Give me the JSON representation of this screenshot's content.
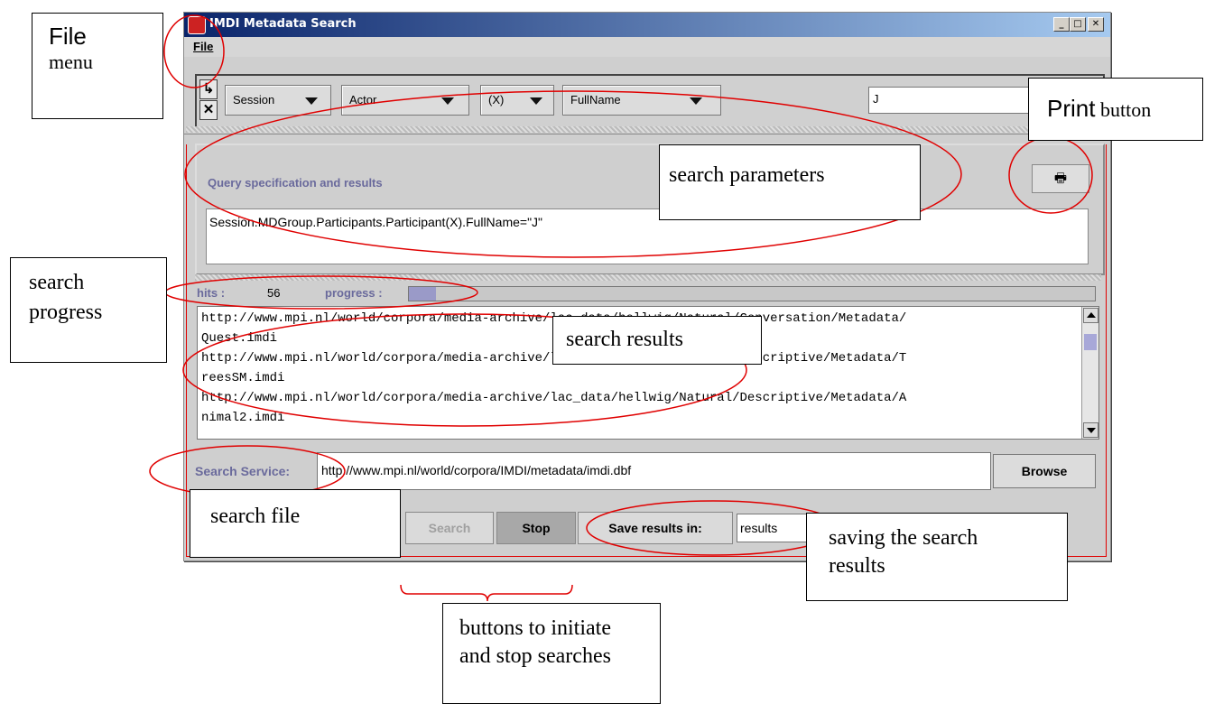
{
  "window": {
    "title": "IMDI Metadata Search",
    "minimize_glyph": "_",
    "maximize_glyph": "□",
    "close_glyph": "✕"
  },
  "menu": {
    "file": "File"
  },
  "query_builder": {
    "icon_insert": "↳",
    "icon_delete": "✕",
    "combos": [
      "Session",
      "Actor",
      "(X)",
      "FullName"
    ],
    "value": "J"
  },
  "query_panel": {
    "heading": "Query specification and results",
    "query": "Session.MDGroup.Participants.Participant(X).FullName=\"J\"",
    "print_icon": "print-icon"
  },
  "progress": {
    "hits_label": "hits :",
    "hits_value": "56",
    "progress_label": "progress :",
    "fraction": 0.04
  },
  "results": {
    "lines": [
      "http://www.mpi.nl/world/corpora/media-archive/lac_data/hellwig/Natural/Conversation/Metadata/",
      "Quest.imdi",
      "http://www.mpi.nl/world/corpora/media-archive/lac_data/hellwig/Natural/Descriptive/Metadata/T",
      "reesSM.imdi",
      "http://www.mpi.nl/world/corpora/media-archive/lac_data/hellwig/Natural/Descriptive/Metadata/A",
      "nimal2.imdi"
    ]
  },
  "service": {
    "label": "Search Service:",
    "url": "http://www.mpi.nl/world/corpora/IMDI/metadata/imdi.dbf",
    "browse": "Browse"
  },
  "actions": {
    "search": "Search",
    "stop": "Stop",
    "save_label": "Save results in:",
    "save_value": "results"
  },
  "annotations": {
    "file_menu_1": "File",
    "file_menu_2": "menu",
    "print_1": "Print",
    "print_2": " button",
    "search_parameters": "search parameters",
    "search_progress_1": "search",
    "search_progress_2": "progress",
    "search_results": "search results",
    "search_file": "search file",
    "saving_1": "saving the search",
    "saving_2": "results",
    "buttons_1": "buttons to initiate",
    "buttons_2": "and stop searches"
  },
  "colors": {
    "annotation_red": "#e00000",
    "label_blue": "#6a6a9c",
    "title_dark": "#0a246a",
    "title_light": "#a6caf0"
  }
}
